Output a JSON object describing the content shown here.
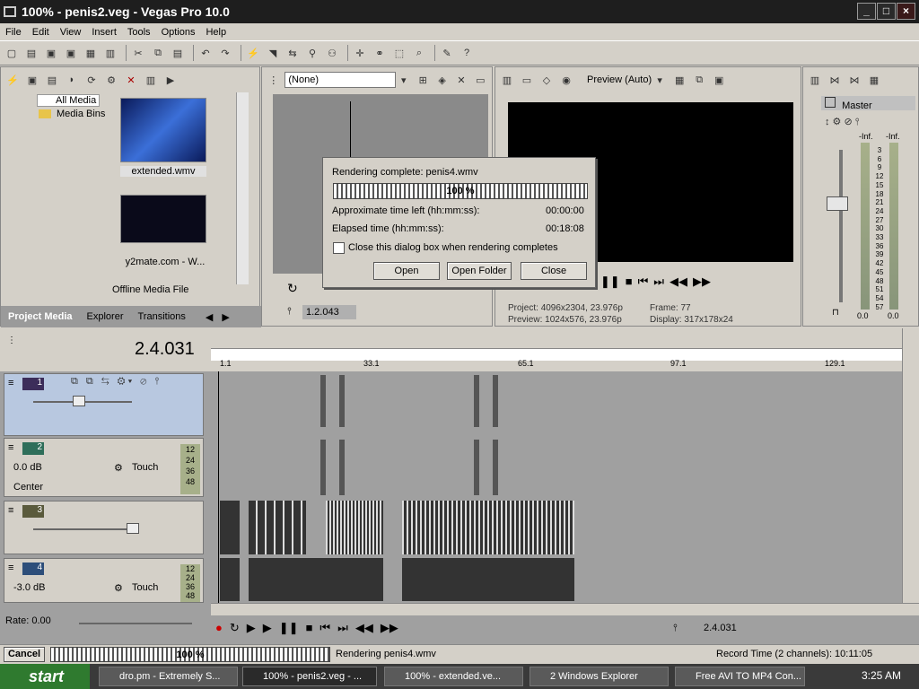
{
  "window": {
    "title": "100% - penis2.veg - Vegas Pro 10.0",
    "minimize": "_",
    "maximize": "□",
    "close": "×"
  },
  "menu": [
    "File",
    "Edit",
    "View",
    "Insert",
    "Tools",
    "Options",
    "Help"
  ],
  "media": {
    "tree": [
      {
        "label": "All Media"
      },
      {
        "label": "Media Bins"
      }
    ],
    "files": [
      {
        "name": "extended.wmv"
      },
      {
        "name": "y2mate.com - W..."
      }
    ],
    "offline_label": "Offline Media File",
    "tabs": [
      "Project Media",
      "Explorer",
      "Transitions"
    ]
  },
  "trimmer": {
    "source_select": "(None)",
    "timecode": "1.2.043"
  },
  "preview": {
    "mode": "Preview (Auto)",
    "project": "Project:",
    "project_value": "4096x2304, 23.976p",
    "preview": "Preview:",
    "preview_value": "1024x576, 23.976p",
    "frame_label": "Frame:",
    "frame_value": "77",
    "display_label": "Display:",
    "display_value": "317x178x24"
  },
  "master": {
    "label": "Master",
    "inf_left": "-Inf.",
    "inf_right": "-Inf.",
    "scale": [
      "3",
      "6",
      "9",
      "12",
      "15",
      "18",
      "21",
      "24",
      "27",
      "30",
      "33",
      "36",
      "39",
      "42",
      "45",
      "48",
      "51",
      "54",
      "57"
    ],
    "bottom_left": "0.0",
    "bottom_right": "0.0"
  },
  "timeline": {
    "cursor_time": "2.4.031",
    "ruler_marks": [
      "1.1",
      "33.1",
      "65.1",
      "97.1",
      "129.1"
    ],
    "tracks": [
      {
        "number": "1",
        "type": "video"
      },
      {
        "number": "2",
        "type": "audio",
        "volume": "0.0 dB",
        "pan": "Center",
        "mode": "Touch",
        "meter": [
          "12",
          "24",
          "36",
          "48"
        ]
      },
      {
        "number": "3",
        "type": "video"
      },
      {
        "number": "4",
        "type": "audio",
        "volume": "-3.0 dB",
        "mode": "Touch",
        "meter": [
          "12",
          "24",
          "36",
          "48"
        ]
      }
    ],
    "rate": "Rate: 0.00",
    "transport_time": "2.4.031"
  },
  "dialog": {
    "message": "Rendering complete: penis4.wmv",
    "progress_text": "100 %",
    "progress": 1.0,
    "time_left_label": "Approximate time left (hh:mm:ss):",
    "time_left": "00:00:00",
    "elapsed_label": "Elapsed time (hh:mm:ss):",
    "elapsed": "00:18:08",
    "checkbox_label": "Close this dialog box when rendering completes",
    "buttons": {
      "open": "Open",
      "open_folder": "Open Folder",
      "close": "Close"
    }
  },
  "status": {
    "cancel": "Cancel",
    "progress_text": "100 %",
    "rendering": "Rendering penis4.wmv",
    "record_time": "Record Time (2 channels): 10:11:05"
  },
  "taskbar": {
    "start": "start",
    "tasks": [
      "dro.pm - Extremely S...",
      "100% - penis2.veg - ...",
      "100% - extended.ve...",
      "2 Windows Explorer",
      "Free AVI TO MP4 Con..."
    ],
    "clock": "3:25 AM"
  },
  "colors": {
    "title_bg": "#1e1e1e",
    "track_video": "#3c2d5a",
    "track_audio": "#2e6e5a",
    "track_video2": "#5a5a3c",
    "track_audio2": "#2d4e7a",
    "selected_track": "#b8c8e0"
  }
}
